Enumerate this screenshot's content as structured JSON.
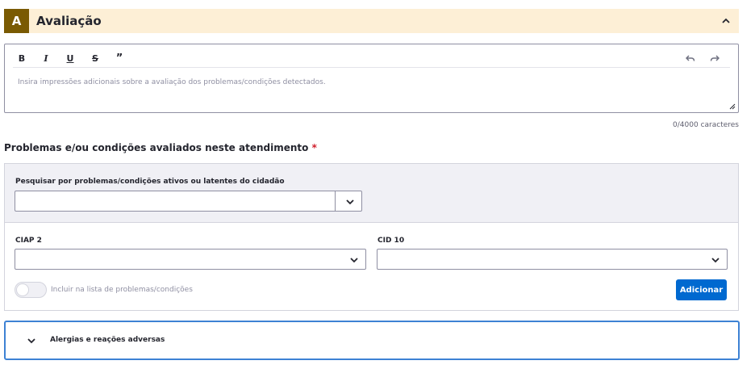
{
  "section": {
    "badge": "A",
    "title": "Avaliação"
  },
  "editor": {
    "toolbar": {
      "bold": "B",
      "italic": "I",
      "underline": "U",
      "strike": "S",
      "quote": "”"
    },
    "placeholder": "Insira impressões adicionais sobre a avaliação dos problemas/condições detectados.",
    "char_count": "0/4000 caracteres"
  },
  "problems": {
    "title": "Problemas e/ou condições avaliados neste atendimento",
    "required_mark": "*",
    "search_label": "Pesquisar por problemas/condições ativos ou latentes do cidadão",
    "search_value": "",
    "ciap_label": "CIAP 2",
    "ciap_value": "",
    "cid_label": "CID 10",
    "cid_value": "",
    "toggle_label": "Incluir na lista de problemas/condições",
    "toggle_on": false,
    "add_label": "Adicionar"
  },
  "allergies": {
    "label": "Alergias e reações adversas"
  },
  "colors": {
    "header_bg": "#fdefd6",
    "badge_bg": "#7a5a02",
    "primary": "#0069d0",
    "required": "#d01e2b"
  },
  "icons": {
    "collapse": "chevron-up-icon",
    "dropdown": "chevron-down-icon",
    "undo": "undo-icon",
    "redo": "redo-icon",
    "expand": "chevron-down-icon"
  }
}
